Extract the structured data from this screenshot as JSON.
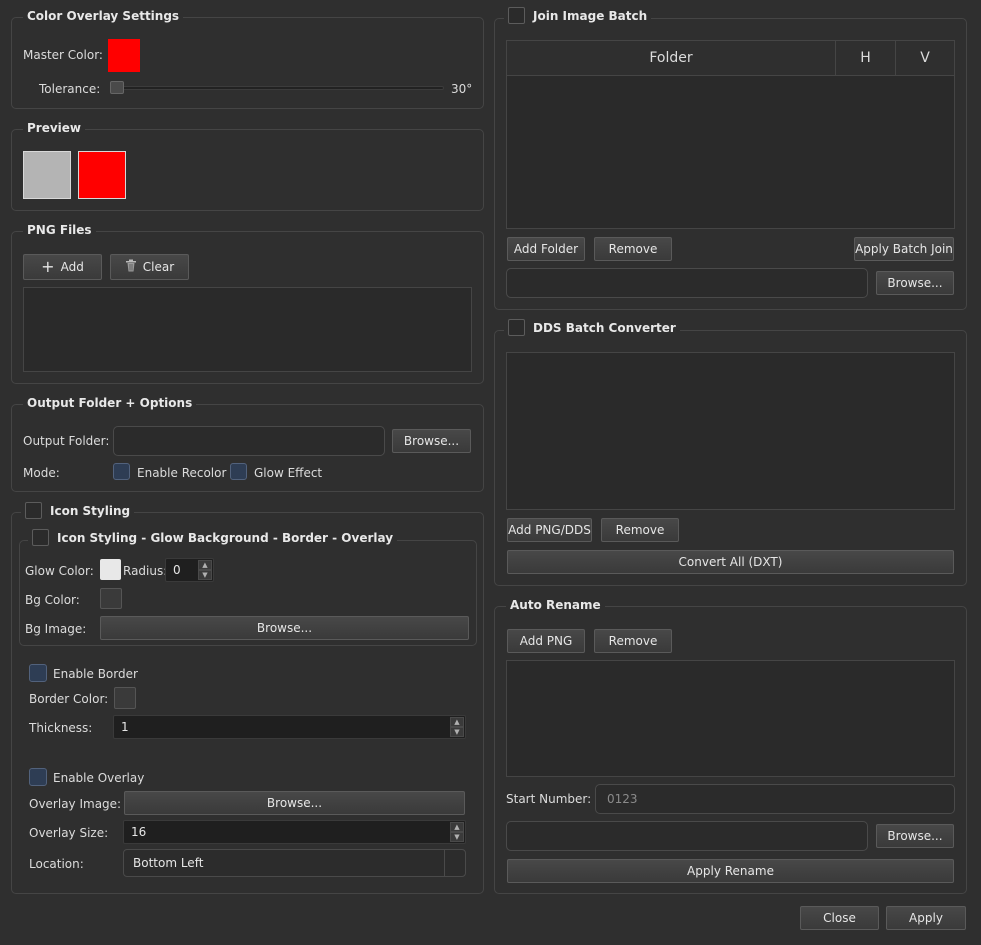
{
  "color_overlay": {
    "title": "Color Overlay Settings",
    "master_color_label": "Master Color:",
    "master_color": "#ff0000",
    "tolerance_label": "Tolerance:",
    "tolerance_value": "30°"
  },
  "preview": {
    "title": "Preview",
    "original_color": "#b4b4b4",
    "result_color": "#ff0000"
  },
  "png_files": {
    "title": "PNG Files",
    "add_label": "Add",
    "clear_label": "Clear"
  },
  "output": {
    "title": "Output Folder + Options",
    "folder_label": "Output Folder:",
    "folder_value": "",
    "browse_label": "Browse...",
    "mode_label": "Mode:",
    "enable_recolor_label": "Enable Recolor",
    "glow_effect_label": "Glow Effect"
  },
  "icon_styling": {
    "title": "Icon Styling",
    "sub_title": "Icon Styling - Glow Background - Border - Overlay",
    "glow_color_label": "Glow Color:",
    "glow_color": "#e8e8e8",
    "radius_label": "Radius:",
    "radius_value": "0",
    "bg_color_label": "Bg Color:",
    "bg_color": "#3a3a3a",
    "bg_image_label": "Bg Image:",
    "bg_browse_label": "Browse...",
    "enable_border_label": "Enable Border",
    "border_color_label": "Border Color:",
    "border_color": "#3a3a3a",
    "thickness_label": "Thickness:",
    "thickness_value": "1",
    "enable_overlay_label": "Enable Overlay",
    "overlay_image_label": "Overlay Image:",
    "overlay_browse_label": "Browse...",
    "overlay_size_label": "Overlay Size:",
    "overlay_size_value": "16",
    "location_label": "Location:",
    "location_value": "Bottom Left"
  },
  "join_batch": {
    "title": "Join Image Batch",
    "columns": [
      "Folder",
      "H",
      "V"
    ],
    "add_folder_label": "Add Folder",
    "remove_label": "Remove",
    "apply_label": "Apply Batch Join",
    "browse_label": "Browse...",
    "path_value": ""
  },
  "dds": {
    "title": "DDS Batch Converter",
    "add_label": "Add PNG/DDS",
    "remove_label": "Remove",
    "convert_label": "Convert All (DXT)"
  },
  "auto_rename": {
    "title": "Auto Rename",
    "add_label": "Add PNG",
    "remove_label": "Remove",
    "start_label": "Start Number:",
    "start_placeholder": "0123",
    "browse_label": "Browse...",
    "apply_label": "Apply Rename"
  },
  "footer": {
    "close_label": "Close",
    "apply_label": "Apply"
  }
}
